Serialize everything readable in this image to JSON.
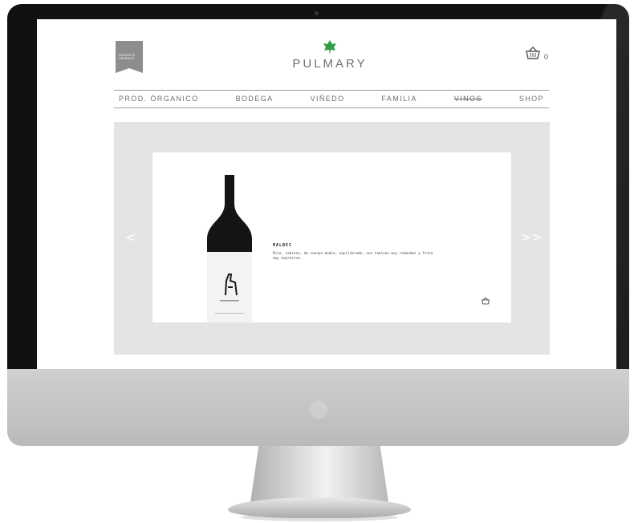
{
  "header": {
    "badge_text": "PRODUCTO ORGÁNICO",
    "brand": "PULMARY",
    "cart_count": "0",
    "colors": {
      "leaf": "#2f9e44",
      "text": "#707070",
      "badge": "#8d8d8d"
    }
  },
  "nav": {
    "items": [
      {
        "label": "PROD. ÓRGANICO"
      },
      {
        "label": "BODEGA"
      },
      {
        "label": "VIÑEDO"
      },
      {
        "label": "FAMILIA"
      },
      {
        "label": "VINOS"
      },
      {
        "label": "SHOP"
      }
    ]
  },
  "slider": {
    "prev_arrow": "<",
    "next_arrow": ">>",
    "product": {
      "name": "MALBEC",
      "description": "Rico, sabroso, de cuerpo medio, equilibrado, con taninos muy redondos y fruta muy expresiva."
    }
  }
}
